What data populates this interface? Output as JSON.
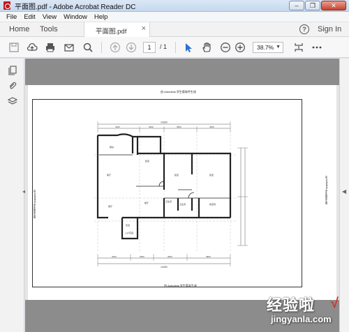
{
  "window": {
    "title": "平面图.pdf - Adobe Acrobat Reader DC"
  },
  "menu": [
    "File",
    "Edit",
    "View",
    "Window",
    "Help"
  ],
  "nav": {
    "home": "Home",
    "tools": "Tools",
    "tab_label": "平面图.pdf",
    "sign_in": "Sign In",
    "help_glyph": "?"
  },
  "toolbar": {
    "page_current": "1",
    "page_total": "/ 1",
    "zoom": "38.7%"
  },
  "document": {
    "sheet_title": "由 Autodesk 学生版软件生成",
    "sheet_footer": "由 Autodesk 学生版本生成",
    "side_left": "由 Autodesk 学生版本生成",
    "side_right": "由 Autodesk 学生版本生成",
    "dims": {
      "top_total": "14300",
      "top_parts": [
        "4400",
        "2600",
        "3500",
        "3500"
      ],
      "bottom_total": "14300",
      "bottom_parts": [
        "3400",
        "2500",
        "3600",
        "4800"
      ]
    },
    "rooms": [
      "厨房",
      "客厅",
      "卧室",
      "卧室",
      "卧室",
      "客厅",
      "餐厅",
      "卫生间",
      "卫生间",
      "卧室间",
      "走道",
      "入户花园"
    ]
  },
  "watermark": {
    "line1": "经验啦",
    "line2": "jingyanla.com",
    "check": "√"
  }
}
